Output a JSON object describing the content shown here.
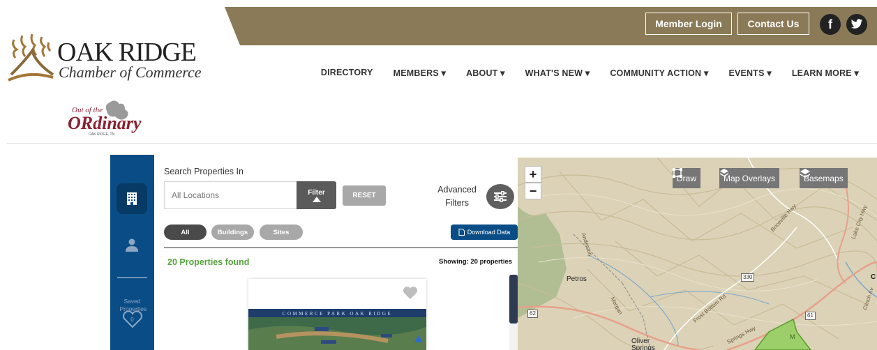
{
  "header": {
    "member_login": "Member Login",
    "contact_us": "Contact Us",
    "facebook_glyph": "f",
    "twitter_glyph": "t",
    "brand_color": "#8b7a57"
  },
  "logo": {
    "title": "OAK RIDGE",
    "subtitle": "Chamber of Commerce"
  },
  "nav": {
    "items": [
      "DIRECTORY",
      "MEMBERS ▾",
      "ABOUT ▾",
      "WHAT'S NEW ▾",
      "COMMUNITY ACTION ▾",
      "EVENTS ▾",
      "LEARN MORE ▾"
    ]
  },
  "ooo_logo": {
    "line1": "Out of the",
    "line2": "ORdinary",
    "line3": "OAK RIDGE, TN"
  },
  "sidebar": {
    "buildings_icon": "building-icon",
    "user_icon": "user-icon",
    "saved_label": "Saved Properties",
    "saved_count": "0",
    "color": "#0a4d86"
  },
  "search": {
    "label": "Search Properties In",
    "placeholder": "All Locations",
    "filter_label": "Filter",
    "reset_label": "RESET",
    "advanced_label": "Advanced Filters",
    "tabs": [
      "All",
      "Buildings",
      "Sites"
    ],
    "download_label": "Download Data",
    "found_text": "20 Properties found",
    "showing_text": "Showing: 20 properties"
  },
  "card": {
    "image_title": "COMMERCE PARK OAK RIDGE"
  },
  "map": {
    "zoom_in": "+",
    "zoom_out": "−",
    "tools": [
      "Draw",
      "Map Overlays",
      "Basemaps"
    ],
    "place_petros": "Petros",
    "place_oliver": "Oliver Springs",
    "road_anderson": "Anderson",
    "road_briceville": "Briceville Hwy",
    "road_lake_city": "Lake City Hwy",
    "road_frost_bottom": "Frost Bottom Rd",
    "road_morgan": "Morgan",
    "road_springs": "Springs Hwy",
    "road_clinch": "Clinch Av",
    "shield_330": "330",
    "shield_62": "62",
    "shield_61": "61",
    "letter_c": "C",
    "letter_m": "M"
  }
}
